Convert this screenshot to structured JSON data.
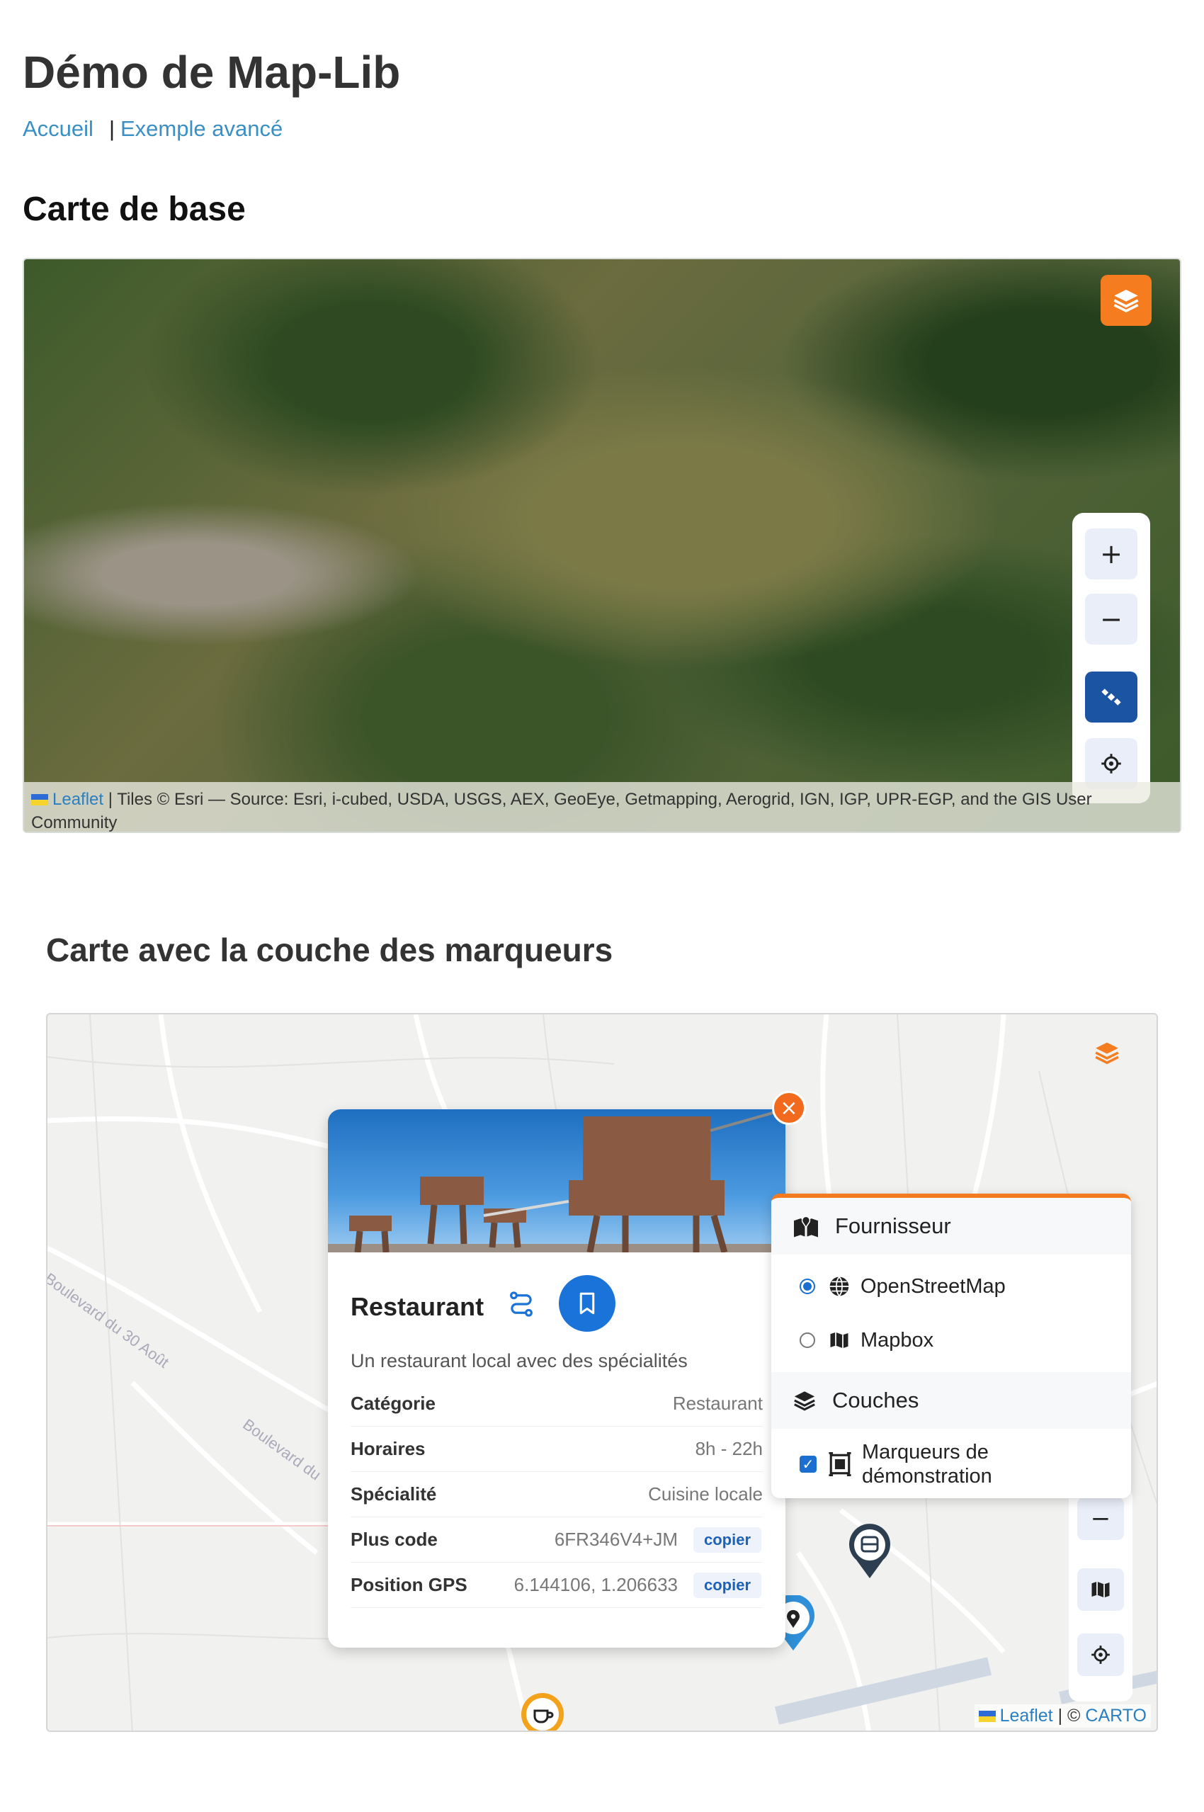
{
  "page": {
    "title": "Démo de Map-Lib",
    "nav": {
      "home": "Accueil",
      "separator": "|",
      "advanced": "Exemple avancé"
    }
  },
  "section_base": {
    "heading": "Carte de base",
    "controls": {
      "zoom_in": "+",
      "zoom_out": "−"
    },
    "attribution": {
      "leaflet": "Leaflet",
      "text": " | Tiles © Esri — Source: Esri, i-cubed, USDA, USGS, AEX, GeoEye, Getmapping, Aerogrid, IGN, IGP, UPR-EGP, and the GIS User Community"
    }
  },
  "section_markers": {
    "heading": "Carte avec la couche des marqueurs",
    "road_labels": [
      "Boulevard du 30 Août",
      "Boulevard du"
    ],
    "popup": {
      "title": "Restaurant",
      "description": "Un restaurant local avec des spécialités",
      "rows": [
        {
          "label": "Catégorie",
          "value": "Restaurant"
        },
        {
          "label": "Horaires",
          "value": "8h - 22h"
        },
        {
          "label": "Spécialité",
          "value": "Cuisine locale"
        },
        {
          "label": "Plus code",
          "value": "6FR346V4+JM",
          "action": "copier"
        },
        {
          "label": "Position GPS",
          "value": "6.144106, 1.206633",
          "action": "copier"
        }
      ],
      "close": "×"
    },
    "layers_panel": {
      "provider_heading": "Fournisseur",
      "providers": [
        {
          "label": "OpenStreetMap",
          "selected": true
        },
        {
          "label": "Mapbox",
          "selected": false
        }
      ],
      "layers_heading": "Couches",
      "layers": [
        {
          "label_line1": "Marqueurs de",
          "label_line2": "démonstration",
          "checked": true
        }
      ]
    },
    "controls": {
      "zoom_out": "−"
    },
    "attribution": {
      "leaflet": "Leaflet",
      "sep": " | © ",
      "carto": "CARTO"
    }
  },
  "colors": {
    "accent_orange": "#f57c1f",
    "primary_blue": "#1c54a4",
    "link": "#3a8fc4"
  }
}
